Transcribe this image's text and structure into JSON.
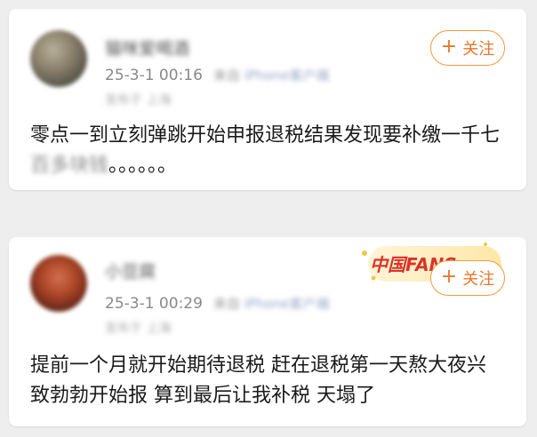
{
  "posts": [
    {
      "username": "猫咪爱喝酒",
      "time": "25-3-1 00:16",
      "device_prefix": "来自",
      "device": "iPhone客户端",
      "location": "发布于 上海",
      "follow_label": "关注",
      "text_before": "零点一到立刻弹跳开始申报退税结果发现要补缴一千七",
      "text_redacted": "百多块钱",
      "text_after": "。。。。。。"
    },
    {
      "username": "小豆腐",
      "time": "25-3-1 00:29",
      "device_prefix": "来自",
      "device": "iPhone客户端",
      "location": "发布于 上海",
      "follow_label": "关注",
      "badge_text": "中国FANS",
      "text": "提前一个月就开始期待退税 赶在退税第一天熬大夜兴致勃勃开始报 算到最后让我补税 天塌了"
    }
  ],
  "colors": {
    "accent": "#e8772a",
    "accent_border": "#f19a3e",
    "badge_red": "#d9342b",
    "badge_gold": "#f5c542"
  }
}
